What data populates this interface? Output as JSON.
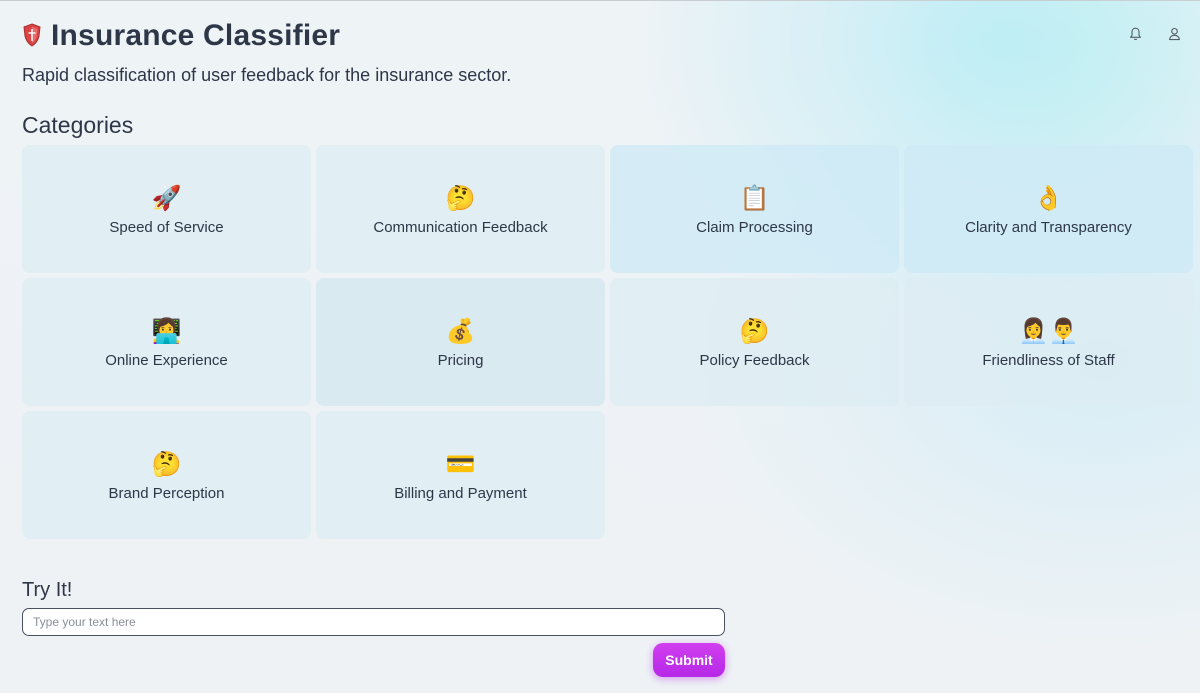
{
  "app": {
    "title": "Insurance Classifier",
    "subtitle": "Rapid classification of user feedback for the insurance sector.",
    "logo_icon": "shield-icon"
  },
  "header_icons": [
    "bell-icon",
    "user-icon"
  ],
  "categories": {
    "title": "Categories",
    "items": [
      {
        "emoji": "🚀",
        "label": "Speed of Service"
      },
      {
        "emoji": "🤔",
        "label": "Communication Feedback"
      },
      {
        "emoji": "📋",
        "label": "Claim Processing"
      },
      {
        "emoji": "👌",
        "label": "Clarity and Transparency"
      },
      {
        "emoji": "👩‍💻",
        "label": "Online Experience"
      },
      {
        "emoji": "💰",
        "label": "Pricing"
      },
      {
        "emoji": "🤔",
        "label": "Policy Feedback"
      },
      {
        "emoji": "👩‍💼👨‍💼",
        "label": "Friendliness of Staff"
      },
      {
        "emoji": "🤔",
        "label": "Brand Perception"
      },
      {
        "emoji": "💳",
        "label": "Billing and Payment"
      }
    ]
  },
  "try_it": {
    "title": "Try It!",
    "input_placeholder": "Type your text here",
    "input_value": "",
    "submit_label": "Submit"
  },
  "colors": {
    "accent": "#c235eb",
    "text": "#2d3748",
    "card_bg": "#dcecf2"
  }
}
